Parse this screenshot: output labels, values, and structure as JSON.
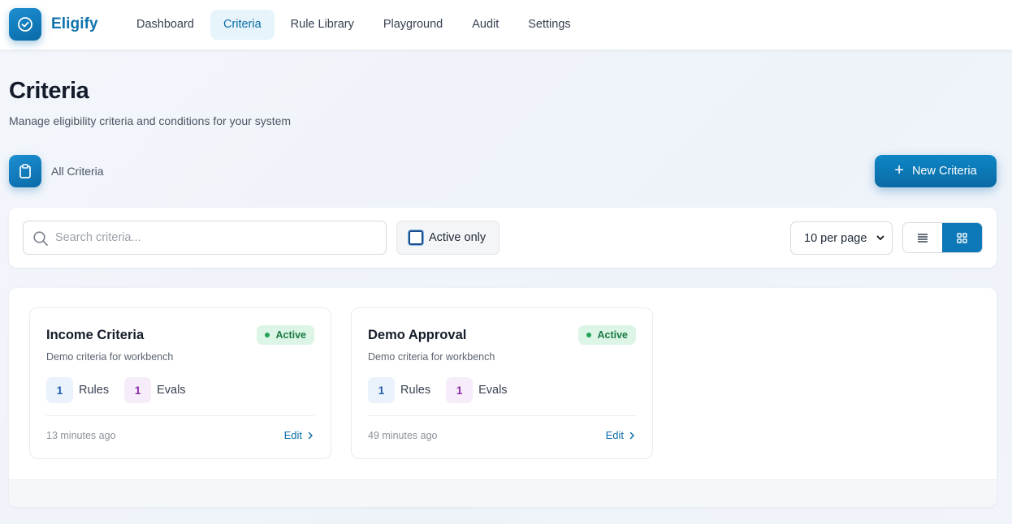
{
  "app": {
    "brand": "Eligify",
    "nav": [
      {
        "label": "Dashboard",
        "active": false
      },
      {
        "label": "Criteria",
        "active": true
      },
      {
        "label": "Rule Library",
        "active": false
      },
      {
        "label": "Playground",
        "active": false
      },
      {
        "label": "Audit",
        "active": false
      },
      {
        "label": "Settings",
        "active": false
      }
    ]
  },
  "header": {
    "title": "Criteria",
    "subtitle": "Manage eligibility criteria and conditions for your system"
  },
  "section": {
    "label": "All Criteria",
    "new_button": "New Criteria"
  },
  "filters": {
    "search_placeholder": "Search criteria...",
    "search_value": "",
    "active_only_label": "Active only",
    "active_only_checked": false,
    "per_page": "10 per page",
    "view_mode": "grid"
  },
  "criteria": [
    {
      "name": "Income Criteria",
      "status": "Active",
      "description": "Demo criteria for workbench",
      "rules_count": "1",
      "rules_label": "Rules",
      "evals_count": "1",
      "evals_label": "Evals",
      "updated": "13 minutes ago",
      "edit_label": "Edit"
    },
    {
      "name": "Demo Approval",
      "status": "Active",
      "description": "Demo criteria for workbench",
      "rules_count": "1",
      "rules_label": "Rules",
      "evals_count": "1",
      "evals_label": "Evals",
      "updated": "49 minutes ago",
      "edit_label": "Edit"
    }
  ],
  "colors": {
    "primary": "#0c78b8",
    "brand_text": "#0e72ad",
    "active_badge_bg": "#dcf5e6",
    "active_badge_text": "#1b7a43",
    "rules_badge_bg": "#eaf2fc",
    "evals_badge_bg": "#f6ecfa"
  },
  "icons": {
    "logo": "check-circle-icon",
    "section": "clipboard-icon",
    "search": "search-icon",
    "list_view": "list-icon",
    "grid_view": "grid-icon",
    "edit_arrow": "chevron-right-icon",
    "add": "plus-icon"
  }
}
